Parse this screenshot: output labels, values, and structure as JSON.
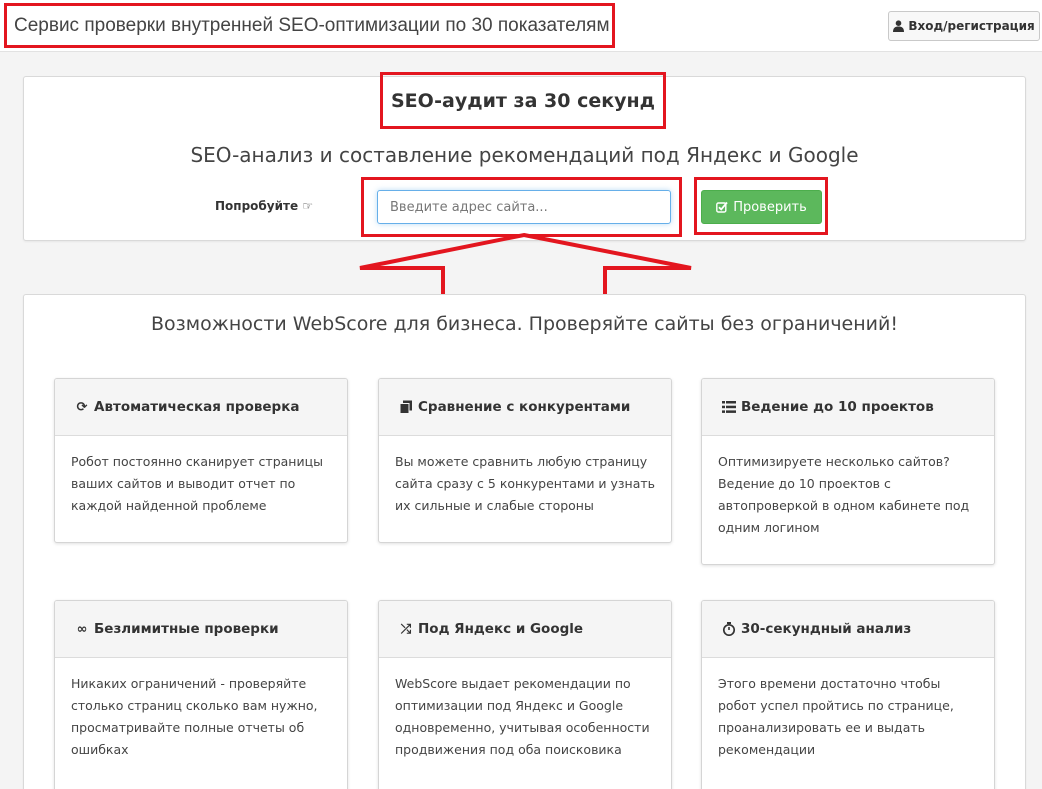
{
  "header": {
    "site_title": "Сервис проверки внутренней SEO-оптимизации по 30 показателям",
    "login_label": "Вход/регистрация"
  },
  "hero": {
    "title": "SEO-аудит за 30 секунд",
    "subtitle": "SEO-анализ и составление рекомендаций под Яндекс и Google",
    "try_label": "Попробуйте",
    "url_placeholder": "Введите адрес сайта...",
    "check_label": "Проверить"
  },
  "features": {
    "heading": "Возможности WebScore для бизнеса. Проверяйте сайты без ограничений!",
    "cards": [
      {
        "icon": "refresh-icon",
        "title": "Автоматическая проверка",
        "text": "Робот постоянно сканирует страницы ваших сайтов и выводит отчет по каждой найденной проблеме"
      },
      {
        "icon": "copy-icon",
        "title": "Сравнение с конкурентами",
        "text": "Вы можете сравнить любую страницу сайта сразу с 5 конкурентами и узнать их сильные и слабые стороны"
      },
      {
        "icon": "list-icon",
        "title": "Ведение до 10 проектов",
        "text": "Оптимизируете несколько сайтов? Ведение до 10 проектов с автопроверкой в одном кабинете под одним логином"
      },
      {
        "icon": "infinity-icon",
        "title": "Безлимитные проверки",
        "text": "Никаких ограничений - проверяйте столько страниц сколько вам нужно, просматривайте полные отчеты об ошибках"
      },
      {
        "icon": "shuffle-icon",
        "title": "Под Яндекс и Google",
        "text": "WebScore выдает рекомендации по оптимизации под Яндекс и Google одновременно, учитывая особенности продвижения под оба поисковика"
      },
      {
        "icon": "stopwatch-icon",
        "title": "30-секундный анализ",
        "text": "Этого времени достаточно чтобы робот успел пройтись по странице, проанализировать ее и выдать рекомендации"
      }
    ]
  },
  "colors": {
    "highlight": "#e3161f",
    "primary_button": "#5cb85c"
  }
}
